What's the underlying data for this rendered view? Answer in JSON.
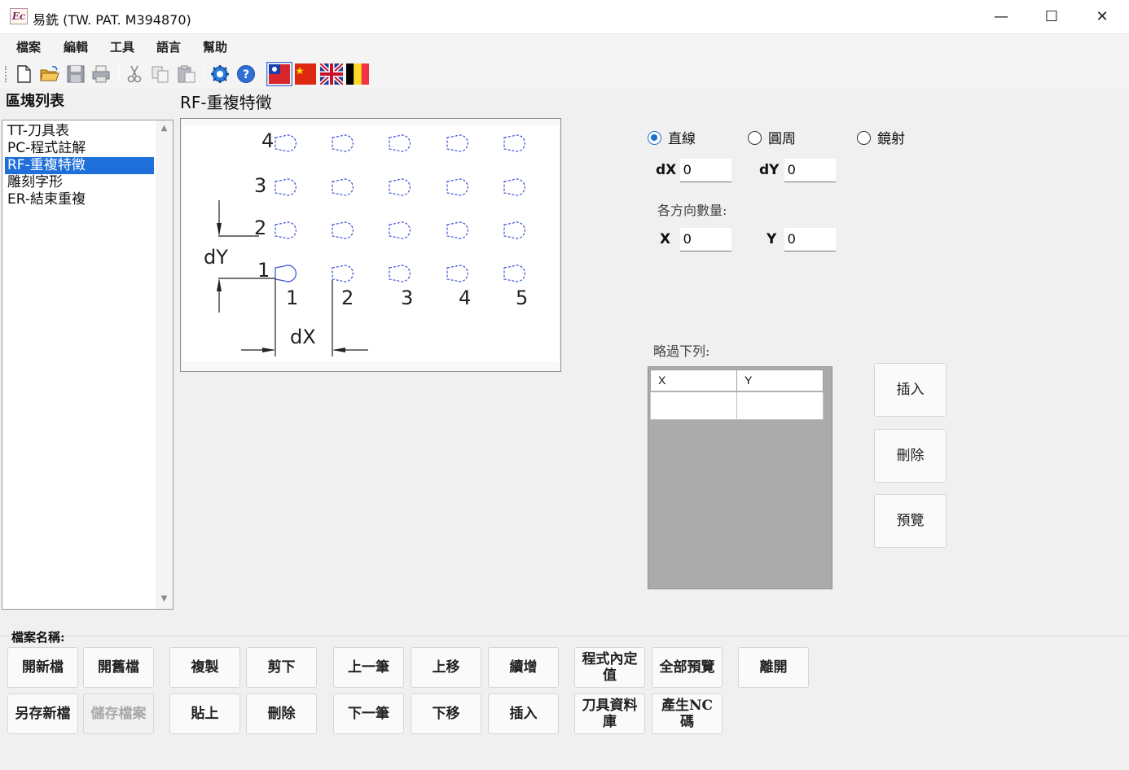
{
  "window": {
    "icon_text": "Ec",
    "title": "易銑 (TW. PAT. M394870)",
    "minimize": "—",
    "maximize": "☐",
    "close": "✕"
  },
  "menu": [
    "檔案",
    "編輯",
    "工具",
    "語言",
    "幫助"
  ],
  "toolbar_icons": [
    "new-file-icon",
    "open-folder-icon",
    "save-icon",
    "print-icon",
    "cut-icon",
    "copy-icon",
    "paste-icon",
    "settings-gear-icon",
    "help-icon",
    "flag-taiwan-icon",
    "flag-china-icon",
    "flag-uk-icon",
    "flag-belgium-icon"
  ],
  "left_panel": {
    "label": "區塊列表",
    "items": [
      "TT-刀具表",
      "PC-程式註解",
      "RF-重複特徵",
      "雕刻字形",
      "ER-結束重複"
    ],
    "selected_index": 2
  },
  "section_title": "RF-重複特徵",
  "diagram": {
    "row_labels": [
      "4",
      "3",
      "2",
      "1"
    ],
    "col_labels": [
      "1",
      "2",
      "3",
      "4",
      "5"
    ],
    "dy_label": "dY",
    "dx_label": "dX"
  },
  "form": {
    "mode_options": [
      "直線",
      "圓周",
      "鏡射"
    ],
    "selected_mode": "直線",
    "dx_label": "dX",
    "dx_value": "0",
    "dy_label": "dY",
    "dy_value": "0",
    "count_caption": "各方向數量:",
    "x_label": "X",
    "x_value": "0",
    "y_label": "Y",
    "y_value": "0",
    "skip_caption": "略過下列:",
    "skip_columns": [
      "X",
      "Y"
    ]
  },
  "side_buttons": {
    "insert": "插入",
    "delete": "刪除",
    "preview": "預覽"
  },
  "bottom": {
    "file_name_label": "檔案名稱:",
    "new_file": "開新檔",
    "open_file": "開舊檔",
    "save_as": "另存新檔",
    "save": "儲存檔案",
    "copy": "複製",
    "cut": "剪下",
    "paste": "貼上",
    "delete": "刪除",
    "prev": "上一筆",
    "move_up": "上移",
    "next": "下一筆",
    "move_down": "下移",
    "append": "續增",
    "insert": "插入",
    "program_constants": "程式內定值",
    "full_preview": "全部預覽",
    "tool_library": "刀具資料庫",
    "generate_nc": "產生NC 碼",
    "exit": "離開"
  },
  "colors": {
    "selection": "#1e6fd9",
    "radio_selected": "#1f6fd1",
    "dashed_outline": "#3a4fd8",
    "grid_background": "#ababab"
  }
}
